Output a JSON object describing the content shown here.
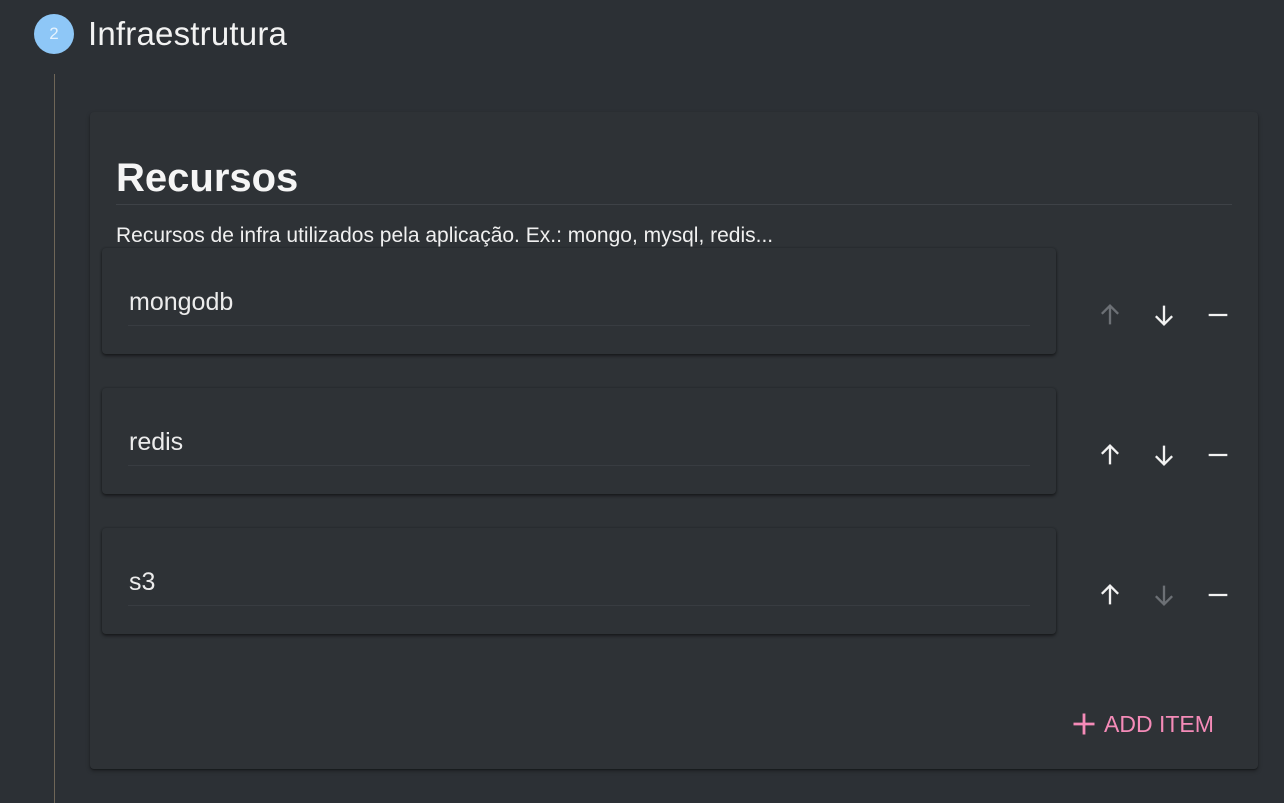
{
  "step": {
    "number": "2",
    "title": "Infraestrutura"
  },
  "section": {
    "title": "Recursos",
    "description": "Recursos de infra utilizados pela aplicação. Ex.: mongo, mysql, redis..."
  },
  "items": [
    {
      "value": "mongodb",
      "up_enabled": false,
      "down_enabled": true
    },
    {
      "value": "redis",
      "up_enabled": true,
      "down_enabled": true
    },
    {
      "value": "s3",
      "up_enabled": true,
      "down_enabled": false
    }
  ],
  "add_item_label": "ADD ITEM",
  "colors": {
    "background": "#2c3035",
    "card": "#2e3236",
    "step_circle": "#8ec7f7",
    "accent": "#f58bb8",
    "disabled_icon": "#6c7075"
  }
}
